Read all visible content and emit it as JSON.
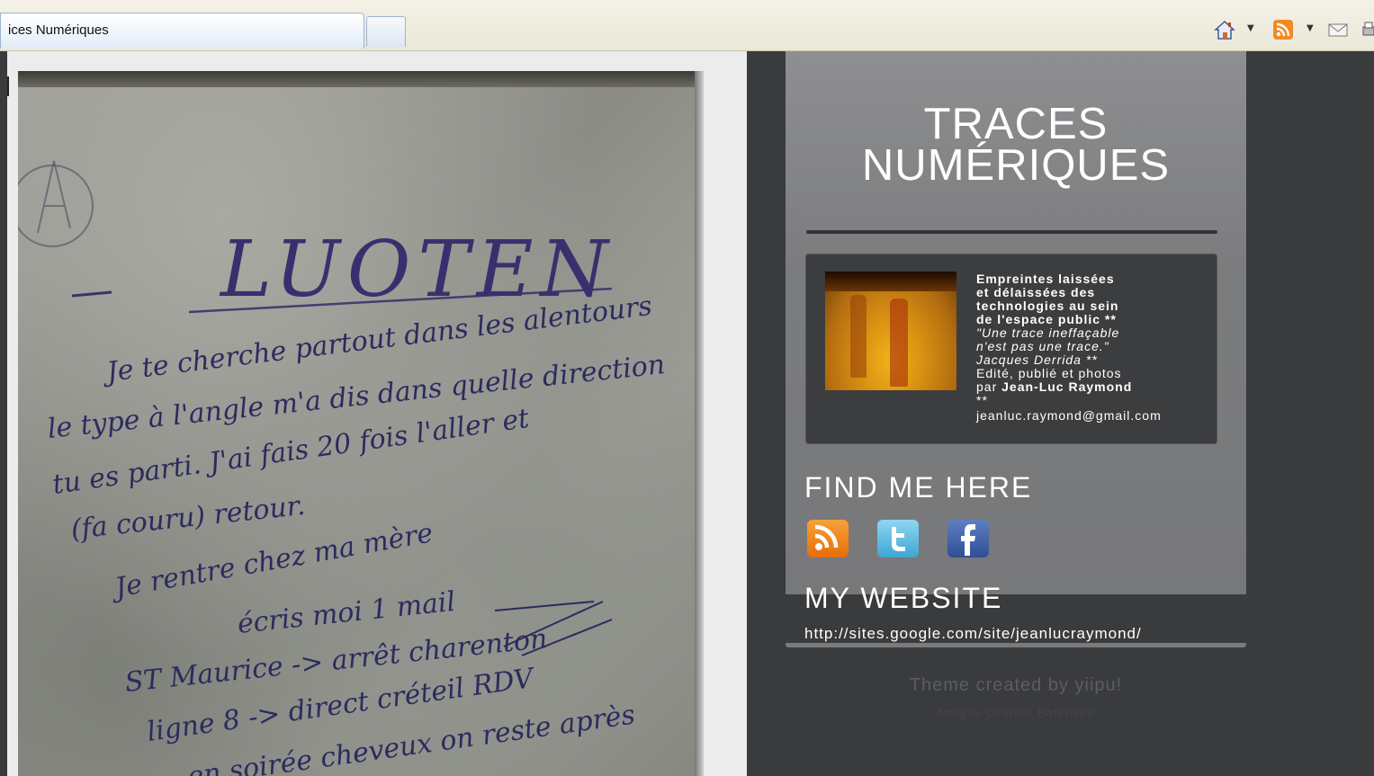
{
  "browser": {
    "tab_title": "ices Numériques",
    "icons": [
      "home-icon",
      "feed-icon",
      "mail-icon",
      "print-icon"
    ]
  },
  "post": {
    "photo_icon": "handwritten-wall-photo",
    "handwriting": {
      "heading": "LUOTEN",
      "lines": [
        "Je te cherche partout dans les alentours",
        "le type à l'angle m'a dis dans quelle direction",
        "tu es parti. J'ai fais 20 fois l'aller et",
        "(fa couru) retour.",
        "Je rentre chez ma mère",
        "écris moi 1 mail",
        "ST Maurice -> arrêt charenton",
        "ligne 8 -> direct créteil RDV",
        "en soirée cheveux on reste après"
      ]
    }
  },
  "sidebar": {
    "title_line1": "TRACES",
    "title_line2": "NUMÉRIQUES",
    "about": {
      "line1": "Empreintes laissées",
      "line2": "et délaissées des",
      "line3": "technologies au sein",
      "line4": "de l'espace public **",
      "quote1": "\"Une trace ineffaçable",
      "quote2": "n'est pas une trace.\"",
      "quote3": "Jacques Derrida **",
      "credit1": "Edité, publié et photos",
      "credit2_prefix": "par ",
      "credit2_name": "Jean-Luc Raymond",
      "stars": "**",
      "email": "jeanluc.raymond@gmail.com"
    },
    "find_me_title": "FIND ME HERE",
    "social": [
      "rss-icon",
      "twitter-icon",
      "facebook-icon"
    ],
    "website_title": "MY WEBSITE",
    "website_url": "http://sites.google.com/site/jeanlucraymond/",
    "theme_credit": "Theme created by yiipu!",
    "theme_credit2": "Amigos Chatear Batepapo"
  },
  "colors": {
    "page_bg": "#3a3b3d",
    "sidebar_bg": "#828385",
    "about_bg": "#3c3d3f",
    "rss": "#f08a24",
    "twitter": "#5bbfe6",
    "facebook": "#3b5998"
  }
}
